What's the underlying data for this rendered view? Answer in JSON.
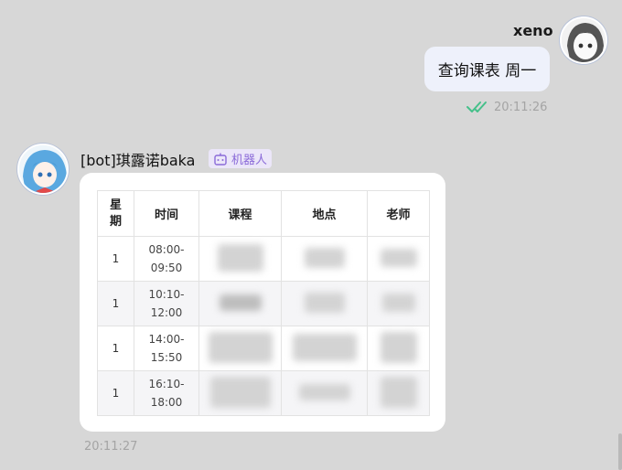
{
  "outgoing": {
    "sender": "xeno",
    "message": "查询课表 周一",
    "time": "20:11:26",
    "read_icon": "double-check-icon",
    "read_color": "#45c08a"
  },
  "incoming": {
    "sender": "[bot]琪露诺baka",
    "badge_label": "机器人",
    "badge_icon": "robot-icon",
    "time": "20:11:27"
  },
  "schedule": {
    "headers": [
      "星期",
      "时间",
      "课程",
      "地点",
      "老师"
    ],
    "rows": [
      {
        "day": "1",
        "start": "08:00-",
        "end": "09:50"
      },
      {
        "day": "1",
        "start": "10:10-",
        "end": "12:00"
      },
      {
        "day": "1",
        "start": "14:00-",
        "end": "15:50"
      },
      {
        "day": "1",
        "start": "16:10-",
        "end": "18:00"
      }
    ]
  },
  "colors": {
    "background": "#d7d7d7",
    "outgoing_bubble": "#eef1fb",
    "badge_bg": "#ebe6f9",
    "badge_text": "#8a6ad8"
  }
}
